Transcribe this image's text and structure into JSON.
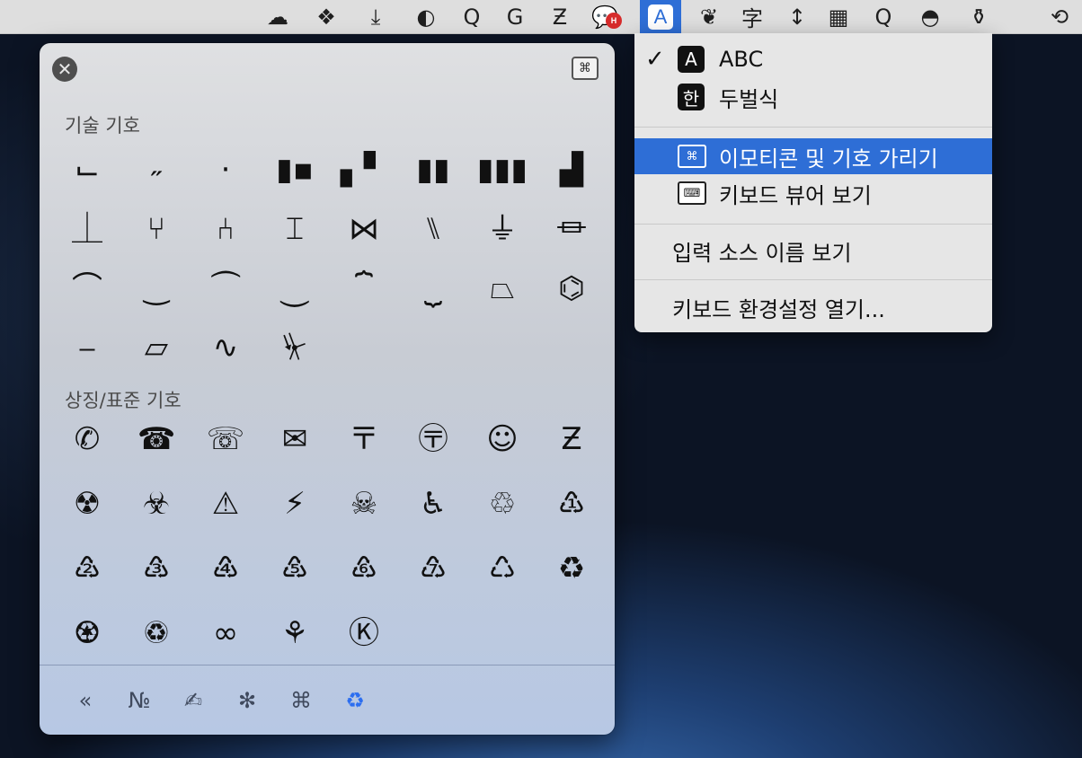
{
  "colors": {
    "accent": "#2e6ed6",
    "selected_category": "#2c6ef0"
  },
  "menubar": {
    "items": [
      {
        "name": "cloud-icon",
        "glyph": "☁"
      },
      {
        "name": "dropbox-icon",
        "glyph": "❖"
      },
      {
        "name": "download-icon",
        "glyph": "⤓"
      },
      {
        "name": "toggle-icon",
        "glyph": "◐"
      },
      {
        "name": "q-app-icon",
        "glyph": "Q"
      },
      {
        "name": "g-app-icon",
        "glyph": "G"
      },
      {
        "name": "z-app-icon",
        "glyph": "Ƶ"
      },
      {
        "name": "chat-icon",
        "glyph": "💬"
      },
      {
        "name": "input-source-icon",
        "glyph": "A"
      },
      {
        "name": "leaf-icon",
        "glyph": "❦"
      },
      {
        "name": "dictionary-icon",
        "glyph": "字"
      },
      {
        "name": "resize-icon",
        "glyph": "↕"
      },
      {
        "name": "grid-icon",
        "glyph": "▦"
      },
      {
        "name": "search-app-icon",
        "glyph": "Q"
      },
      {
        "name": "hat-icon",
        "glyph": "◓"
      },
      {
        "name": "broom-icon",
        "glyph": "⚱"
      },
      {
        "name": "time-machine-icon",
        "glyph": "⟲"
      }
    ],
    "chat_badge": "H"
  },
  "panel": {
    "close_glyph": "✕",
    "viewer_toggle_glyph": "⌘",
    "sections": [
      {
        "title": "기술 기호",
        "rows": [
          [
            "⌙",
            "˶",
            "·",
            "▮▪",
            "▖▘",
            "▮▮",
            "▮▮▮",
            "▟"
          ],
          [
            "⏊",
            "⑂",
            "⑃",
            "⌶",
            "⋈",
            "⑊",
            "⏚",
            "⏛"
          ],
          [
            "⌒",
            "‿",
            "⏜",
            "⏝",
            "⏞",
            "⏟",
            "⏢",
            "⌬"
          ],
          [
            "⎯",
            "⏥",
            "∿",
            "⏧"
          ]
        ]
      },
      {
        "title": "상징/표준 기호",
        "rows": [
          [
            "✆",
            "☎",
            "☏",
            "✉",
            "〒",
            "〶",
            "☺",
            "Ƶ"
          ],
          [
            "☢",
            "☣",
            "⚠",
            "⚡",
            "☠",
            "♿",
            "♲",
            "♳"
          ],
          [
            "♴",
            "♵",
            "♶",
            "♷",
            "♸",
            "♹",
            "♺",
            "♻"
          ],
          [
            "♼",
            "♽",
            "∞",
            "⚘",
            "Ⓚ"
          ]
        ]
      }
    ],
    "categories": [
      {
        "name": "category-arrows-icon",
        "glyph": "«"
      },
      {
        "name": "category-letterlike-icon",
        "glyph": "№"
      },
      {
        "name": "category-pictographs-icon",
        "glyph": "✍"
      },
      {
        "name": "category-bullets-stars-icon",
        "glyph": "✻"
      },
      {
        "name": "category-technical-icon",
        "glyph": "⌘"
      },
      {
        "name": "category-signs-standard-icon",
        "glyph": "♻"
      }
    ]
  },
  "dropdown": {
    "check_glyph": "✓",
    "input_sources": [
      {
        "badge": "A",
        "label": "ABC",
        "checked": true
      },
      {
        "badge": "한",
        "label": "두벌식",
        "checked": false
      }
    ],
    "emoji_symbols_label": "이모티콘 및 기호 가리기",
    "keyboard_viewer_label": "키보드 뷰어 보기",
    "show_input_source_name_label": "입력 소스 이름 보기",
    "open_keyboard_prefs_label": "키보드 환경설정 열기..."
  }
}
